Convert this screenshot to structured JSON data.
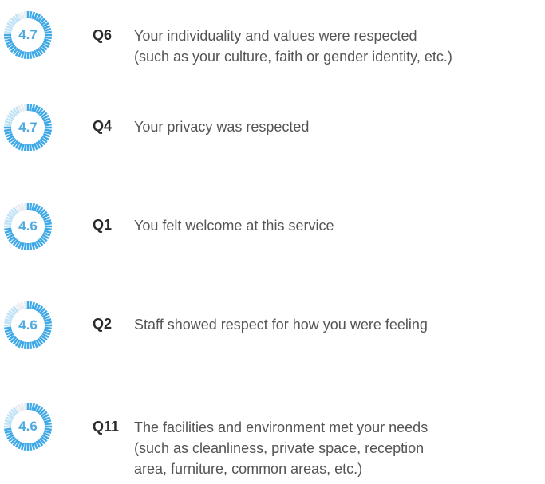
{
  "colors": {
    "gauge_fill": "#3fa9e8",
    "gauge_fill_light": "#bfe2f7",
    "gauge_track": "#e9edf0",
    "gauge_value_text": "#4fa8de"
  },
  "scale_max": 5,
  "items": [
    {
      "score": "4.7",
      "code": "Q6",
      "lines": [
        "Your individuality and values were respected",
        "(such as your culture, faith or gender identity, etc.)"
      ]
    },
    {
      "score": "4.7",
      "code": "Q4",
      "lines": [
        "Your privacy was respected"
      ]
    },
    {
      "score": "4.6",
      "code": "Q1",
      "lines": [
        "You felt welcome at this service"
      ]
    },
    {
      "score": "4.6",
      "code": "Q2",
      "lines": [
        "Staff showed respect for how you were feeling"
      ]
    },
    {
      "score": "4.6",
      "code": "Q11",
      "lines": [
        "The facilities and environment met your needs",
        "(such as cleanliness, private space, reception",
        "area, furniture, common areas, etc.)"
      ]
    }
  ]
}
